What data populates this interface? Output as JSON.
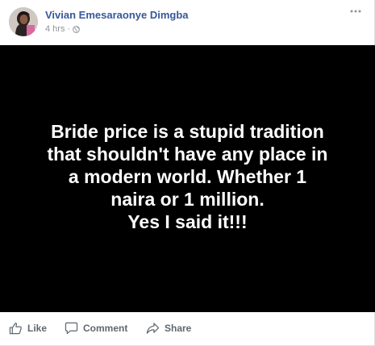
{
  "post": {
    "author": "Vivian Emesaraonye Dimgba",
    "time": "4 hrs",
    "separator": "·",
    "avatar_icon": "profile-photo",
    "privacy_icon": "globe-icon",
    "more_icon": "more-options-icon",
    "image_text": "Bride price is a stupid tradition\nthat shouldn't have any place in\na modern world. Whether 1\nnaira or 1 million.\nYes I said it!!!"
  },
  "actions": {
    "like": "Like",
    "comment": "Comment",
    "share": "Share"
  },
  "colors": {
    "author_link": "#365899",
    "meta_text": "#90949c",
    "action_text": "#606770",
    "image_background": "#000000",
    "image_text": "#ffffff"
  }
}
